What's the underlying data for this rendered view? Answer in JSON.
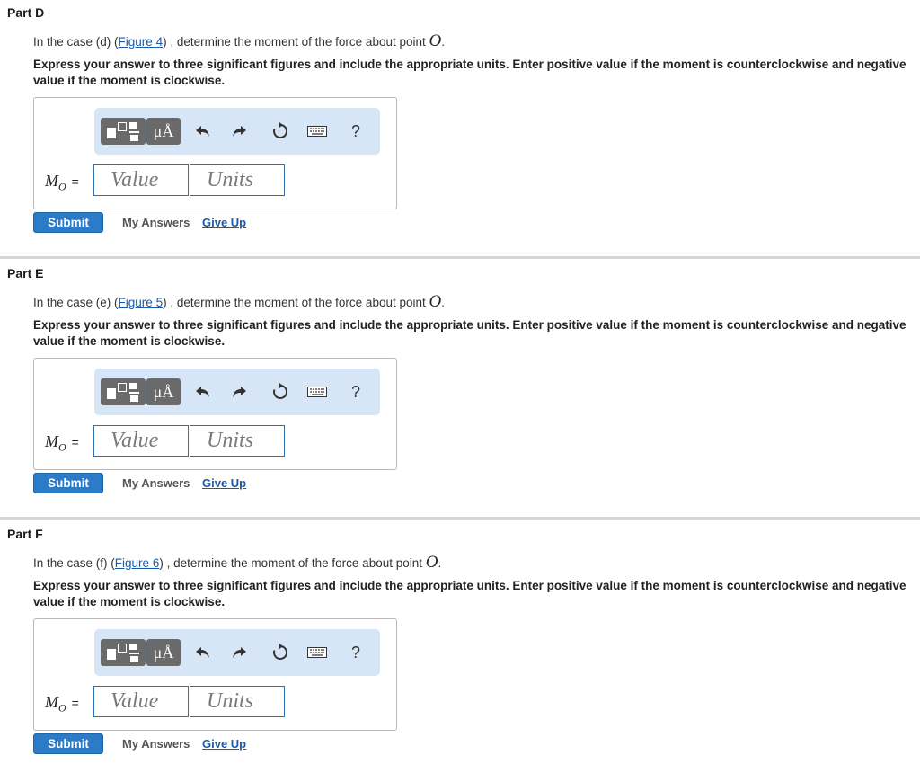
{
  "parts": [
    {
      "title": "Part D",
      "question_prefix": "In the case (d) (",
      "figure_link": "Figure 4",
      "question_suffix": ") , determine the moment of the force about point ",
      "point": "O",
      "question_end": ".",
      "instructions": "Express your answer to three significant figures and include the appropriate units. Enter positive value if the moment is counterclockwise and negative value if the moment is clockwise.",
      "toolbar": {
        "units_button": "μÅ",
        "help": "?"
      },
      "answer_label_main": "M",
      "answer_label_sub": "O",
      "answer_label_eq": "=",
      "value_placeholder": "Value",
      "units_placeholder": "Units",
      "submit": "Submit",
      "my_answers": "My Answers",
      "give_up": "Give Up"
    },
    {
      "title": "Part E",
      "question_prefix": "In the case (e) (",
      "figure_link": "Figure 5",
      "question_suffix": ") , determine the moment of the force about point ",
      "point": "O",
      "question_end": ".",
      "instructions": "Express your answer to three significant figures and include the appropriate units. Enter positive value if the moment is counterclockwise and negative value if the moment is clockwise.",
      "toolbar": {
        "units_button": "μÅ",
        "help": "?"
      },
      "answer_label_main": "M",
      "answer_label_sub": "O",
      "answer_label_eq": "=",
      "value_placeholder": "Value",
      "units_placeholder": "Units",
      "submit": "Submit",
      "my_answers": "My Answers",
      "give_up": "Give Up"
    },
    {
      "title": "Part F",
      "question_prefix": "In the case (f) (",
      "figure_link": "Figure 6",
      "question_suffix": ") , determine the moment of the force about point ",
      "point": "O",
      "question_end": ".",
      "instructions": "Express your answer to three significant figures and include the appropriate units. Enter positive value if the moment is counterclockwise and negative value if the moment is clockwise.",
      "toolbar": {
        "units_button": "μÅ",
        "help": "?"
      },
      "answer_label_main": "M",
      "answer_label_sub": "O",
      "answer_label_eq": "=",
      "value_placeholder": "Value",
      "units_placeholder": "Units",
      "submit": "Submit",
      "my_answers": "My Answers",
      "give_up": "Give Up"
    }
  ],
  "colors": {
    "accent": "#2b7bc8",
    "link": "#1c5aa8",
    "toolbar_bg": "#d7e6f7",
    "toolbar_button": "#6a6a6a"
  },
  "icons": [
    "templates-icon",
    "undo-icon",
    "redo-icon",
    "reset-icon",
    "keyboard-icon",
    "help-icon"
  ]
}
